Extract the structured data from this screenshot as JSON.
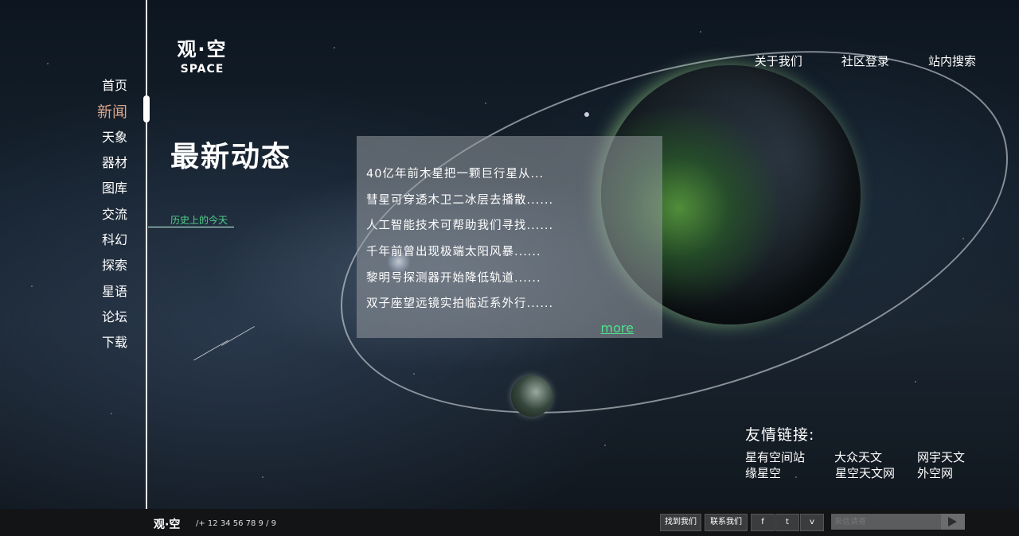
{
  "logo": {
    "cn": "观·空",
    "en": "SPACE"
  },
  "nav": [
    "首页",
    "新闻",
    "天象",
    "器材",
    "图库",
    "交流",
    "科幻",
    "探索",
    "星语",
    "论坛",
    "下载"
  ],
  "nav_active_index": 1,
  "headline": "最新动态",
  "history_label": "历史上的今天",
  "topnav": [
    "关于我们",
    "社区登录",
    "站内搜索"
  ],
  "news": {
    "items": [
      "40亿年前木星把一颗巨行星从...",
      "彗星可穿透木卫二冰层去播散......",
      "人工智能技术可帮助我们寻找......",
      "千年前曾出现极端太阳风暴......",
      "黎明号探测器开始降低轨道......",
      "双子座望远镜实拍临近系外行......"
    ],
    "more": "more"
  },
  "friends": {
    "title": "友情链接:",
    "links": [
      "星有空间站",
      "大众天文",
      "网宇天文",
      "缘星空",
      "星空天文网",
      "外空网"
    ]
  },
  "footer": {
    "logo": "观·空",
    "phone": "/+ 12 34 56 78 9 / 9",
    "buttons": [
      "找到我们",
      "联系我们",
      "f",
      "t",
      "v"
    ],
    "input_placeholder": "来信请寄"
  },
  "colors": {
    "active_nav": "#d9a38a",
    "accent_green": "#4fe08e"
  }
}
